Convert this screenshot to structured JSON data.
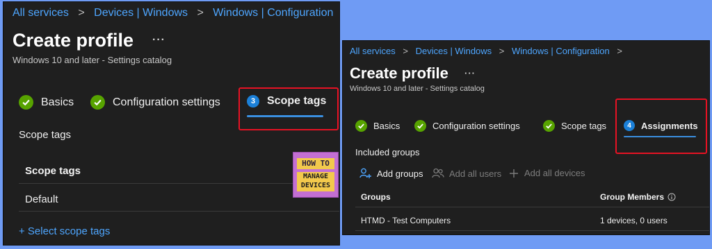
{
  "left_panel": {
    "breadcrumbs": [
      "All services",
      "Devices | Windows",
      "Windows | Configuration"
    ],
    "title": "Create profile",
    "more": "···",
    "subtitle": "Windows 10 and later - Settings catalog",
    "steps": [
      {
        "label": "Basics",
        "status": "complete"
      },
      {
        "label": "Configuration settings",
        "status": "complete"
      },
      {
        "label": "Scope tags",
        "number": "3",
        "status": "active"
      }
    ],
    "section_label": "Scope tags",
    "table": {
      "header": "Scope tags",
      "rows": [
        "Default"
      ]
    },
    "select_link": "+ Select scope tags"
  },
  "logo": {
    "line1": "HOW TO",
    "line2": "MANAGE",
    "line3": "DEVICES"
  },
  "right_panel": {
    "breadcrumbs": [
      "All services",
      "Devices | Windows",
      "Windows | Configuration"
    ],
    "title": "Create profile",
    "more": "···",
    "subtitle": "Windows 10 and later - Settings catalog",
    "steps": [
      {
        "label": "Basics",
        "status": "complete"
      },
      {
        "label": "Configuration settings",
        "status": "complete"
      },
      {
        "label": "Scope tags",
        "status": "complete"
      },
      {
        "label": "Assignments",
        "number": "4",
        "status": "active"
      }
    ],
    "section_label": "Included groups",
    "actions": {
      "add_groups": "Add groups",
      "add_all_users": "Add all users",
      "add_all_devices": "Add all devices"
    },
    "table": {
      "columns": [
        "Groups",
        "Group Members"
      ],
      "rows": [
        {
          "group": "HTMD - Test Computers",
          "members": "1 devices, 0 users"
        }
      ]
    }
  },
  "colors": {
    "background": "#6f9bf4",
    "panel": "#1f1f1f",
    "link": "#4ea6ff",
    "check": "#57a300",
    "active_step": "#1b80d8",
    "highlight": "#e81224"
  }
}
